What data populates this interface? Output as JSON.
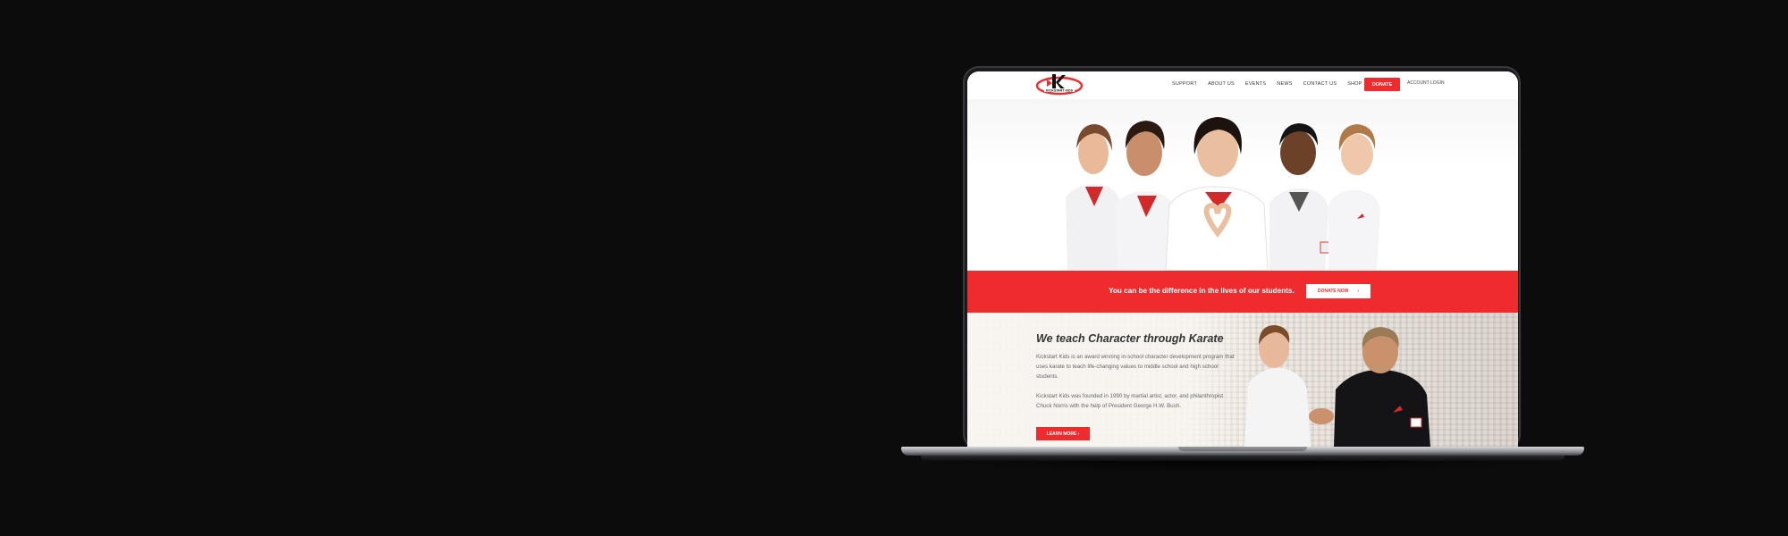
{
  "header": {
    "logo_text": "KICKSTART KIDS",
    "nav": [
      "SUPPORT",
      "ABOUT US",
      "EVENTS",
      "NEWS",
      "CONTACT US",
      "SHOP"
    ],
    "donate_label": "DONATE",
    "account_login_label": "ACCOUNT LOGIN"
  },
  "banner": {
    "text": "You can be the difference in the lives of our students.",
    "button_label": "DONATE NOW",
    "button_arrow": "›"
  },
  "about": {
    "title": "We teach Character through Karate",
    "paragraph_1": "Kickstart Kids is an award winning in-school character development program that uses karate to teach life-changing values to middle school and high school students.",
    "paragraph_2": "Kickstart Kids was founded in 1990 by martial artist, actor, and philanthropist Chuck Norris with the help of President George H.W. Bush.",
    "learn_more_label": "LEARN MORE ›"
  },
  "colors": {
    "brand_red": "#ef2b2d",
    "background": "#0c0c0c"
  }
}
